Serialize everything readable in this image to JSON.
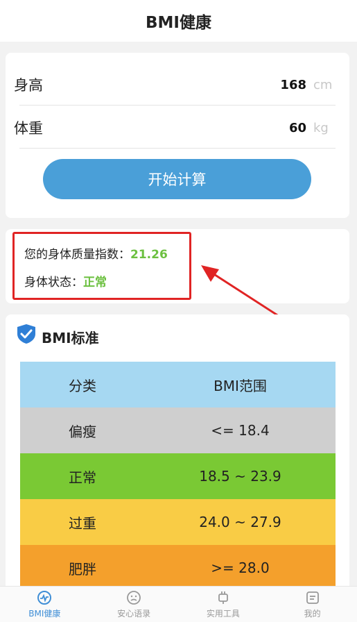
{
  "header": {
    "title": "BMI健康"
  },
  "form": {
    "height": {
      "label": "身高",
      "value": "168",
      "unit": "cm"
    },
    "weight": {
      "label": "体重",
      "value": "60",
      "unit": "kg"
    },
    "calc_button": "开始计算"
  },
  "result": {
    "bmi_label": "您的身体质量指数：",
    "bmi_value": "21.26",
    "status_label": "身体状态：",
    "status_value": "正常"
  },
  "standard": {
    "title": "BMI标准",
    "table": {
      "header": {
        "category": "分类",
        "range": "BMI范围",
        "color": "#a6d8f2"
      },
      "rows": [
        {
          "category": "偏瘦",
          "range": "<= 18.4",
          "color": "#cfcfcf"
        },
        {
          "category": "正常",
          "range": "18.5 ~ 23.9",
          "color": "#7ac934"
        },
        {
          "category": "过重",
          "range": "24.0 ~ 27.9",
          "color": "#f9cc45"
        },
        {
          "category": "肥胖",
          "range": ">= 28.0",
          "color": "#f4a02c"
        }
      ]
    }
  },
  "tabbar": [
    {
      "label": "BMI健康",
      "icon": "pulse-icon",
      "active": true
    },
    {
      "label": "安心语录",
      "icon": "face-icon",
      "active": false
    },
    {
      "label": "实用工具",
      "icon": "plug-icon",
      "active": false
    },
    {
      "label": "我的",
      "icon": "profile-icon",
      "active": false
    }
  ],
  "colors": {
    "accent": "#4a9fd8",
    "good": "#6cc040",
    "highlight": "#e02424"
  }
}
